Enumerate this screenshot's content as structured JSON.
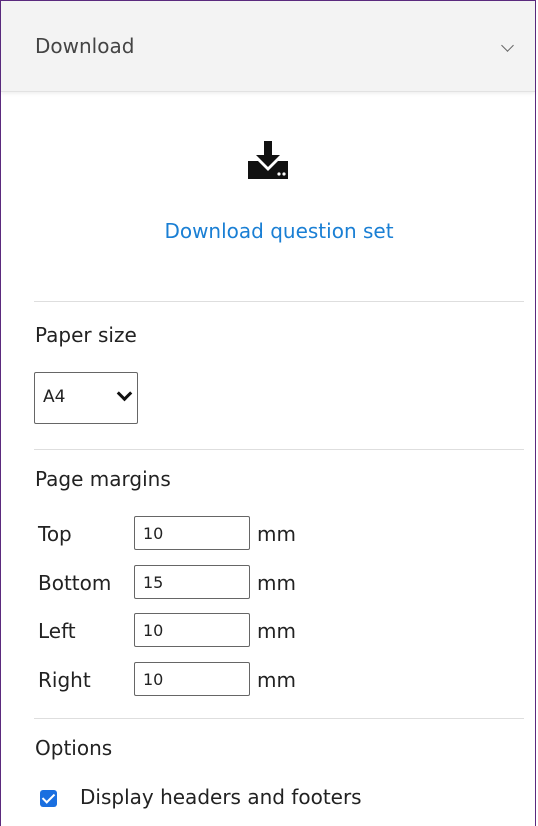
{
  "header": {
    "title": "Download",
    "collapse_icon": "chevron-down-icon"
  },
  "download": {
    "icon": "download-icon",
    "link_label": "Download question set"
  },
  "paper_size": {
    "title": "Paper size",
    "selected": "A4"
  },
  "page_margins": {
    "title": "Page margins",
    "unit": "mm",
    "rows": [
      {
        "label": "Top",
        "value": "10"
      },
      {
        "label": "Bottom",
        "value": "15"
      },
      {
        "label": "Left",
        "value": "10"
      },
      {
        "label": "Right",
        "value": "10"
      }
    ]
  },
  "options": {
    "title": "Options",
    "display_headers_footers": {
      "label": "Display headers and footers",
      "checked": true
    }
  },
  "colors": {
    "accent": "#1a7fd4",
    "checkbox": "#1a6fe0",
    "panel_border": "#5b2a7e"
  }
}
